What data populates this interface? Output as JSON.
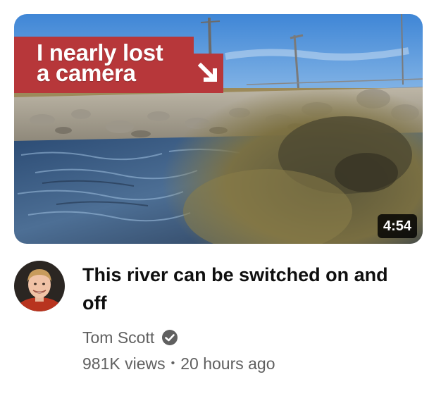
{
  "thumbnail": {
    "overlay_line1": "I nearly lost",
    "overlay_line2": "a camera",
    "duration": "4:54"
  },
  "video": {
    "title": "This river can be switched on and off"
  },
  "channel": {
    "name": "Tom Scott",
    "verified": true
  },
  "meta": {
    "views": "981K views",
    "separator": "•",
    "age": "20 hours ago"
  },
  "colors": {
    "banner": "#b7373a",
    "title_text": "#0f0f0f",
    "secondary_text": "#606060"
  },
  "icons": {
    "overlay_arrow": "arrow-down-right-icon",
    "verified": "check-circle-icon"
  }
}
